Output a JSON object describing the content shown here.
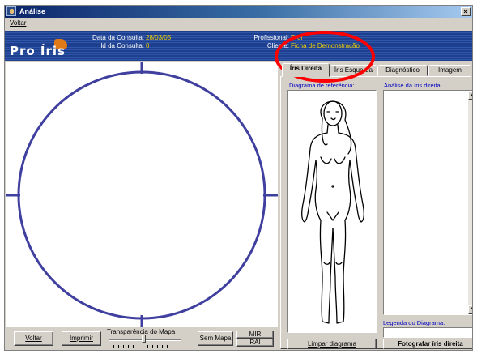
{
  "window": {
    "title": "Análise",
    "close_glyph": "×",
    "app_icon": "app-icon"
  },
  "menu": {
    "items": [
      {
        "label": "Voltar"
      }
    ]
  },
  "header": {
    "logo_text": "Pro Íris",
    "consult_date_label": "Data da Consulta:",
    "consult_date_value": "28/03/05",
    "consult_id_label": "Id da Consulta:",
    "consult_id_value": "0",
    "professional_label": "Profissional:",
    "professional_value": "Prof",
    "client_label": "Cliente:",
    "client_value": "Ficha de Demonstração"
  },
  "iris_map": {
    "shape": "circle-with-cross-ticks",
    "stroke_color": "#3f3fa0"
  },
  "bottom_bar": {
    "back_button": "Voltar",
    "print_button": "Imprimir",
    "transparency_label": "Transparência do Mapa",
    "transparency_level": 0.48,
    "no_map_button": "Sem Mapa",
    "mir_button": "MIR",
    "rai_button": "RAI"
  },
  "tabs": [
    {
      "label": "Íris Direita",
      "active": true
    },
    {
      "label": "Íris Esquerda",
      "active": false
    },
    {
      "label": "Diagnóstico",
      "active": false
    },
    {
      "label": "Imagem",
      "active": false
    }
  ],
  "right_panel": {
    "diagram_label": "Diagrama de referência:",
    "analysis_label": "Análise da íris direita",
    "legend_label": "Legenda do Diagrama:",
    "legend_value": "",
    "clear_diagram_button": "Limpar diagrama",
    "photograph_button": "Fotografar íris direita"
  },
  "annotation": {
    "color": "#ff0000",
    "target": "tab-iris-direita"
  }
}
